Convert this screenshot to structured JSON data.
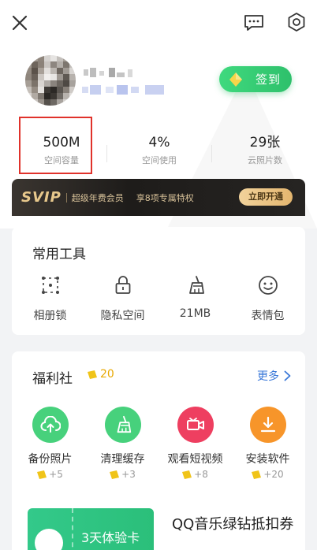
{
  "header": {
    "close_icon": "close-icon",
    "message_icon": "message-icon",
    "settings_icon": "settings-icon"
  },
  "profile": {
    "sign_in_label": "签到"
  },
  "stats": [
    {
      "value": "500M",
      "label": "空间容量"
    },
    {
      "value": "4%",
      "label": "空间使用"
    },
    {
      "value": "29张",
      "label": "云照片数"
    }
  ],
  "svip": {
    "logo": "SVIP",
    "title": "超级年费会员",
    "privilege": "享8项专属特权",
    "button": "立即开通"
  },
  "tools": {
    "title": "常用工具",
    "items": [
      {
        "label": "相册锁",
        "icon": "album-lock-icon"
      },
      {
        "label": "隐私空间",
        "icon": "lock-icon"
      },
      {
        "label": "21MB",
        "icon": "broom-icon"
      },
      {
        "label": "表情包",
        "icon": "smiley-icon"
      }
    ]
  },
  "welfare": {
    "title": "福利社",
    "count": "20",
    "more": "更多",
    "tasks": [
      {
        "label": "备份照片",
        "reward": "+5",
        "color": "#47d17c",
        "icon": "cloud-upload-icon"
      },
      {
        "label": "清理缓存",
        "reward": "+3",
        "color": "#47d17c",
        "icon": "broom-icon"
      },
      {
        "label": "观看短视频",
        "reward": "+8",
        "color": "#ee3f60",
        "icon": "video-icon"
      },
      {
        "label": "安装软件",
        "reward": "+20",
        "color": "#f7952a",
        "icon": "download-icon"
      }
    ],
    "offer": {
      "ticket": "3天体验卡",
      "title": "QQ音乐绿钻抵扣券"
    }
  },
  "colors": {
    "sign_green": "#3fd97e",
    "highlight_red": "#e0322b",
    "link_blue": "#3a78d8",
    "coin_yellow": "#f0c419"
  }
}
